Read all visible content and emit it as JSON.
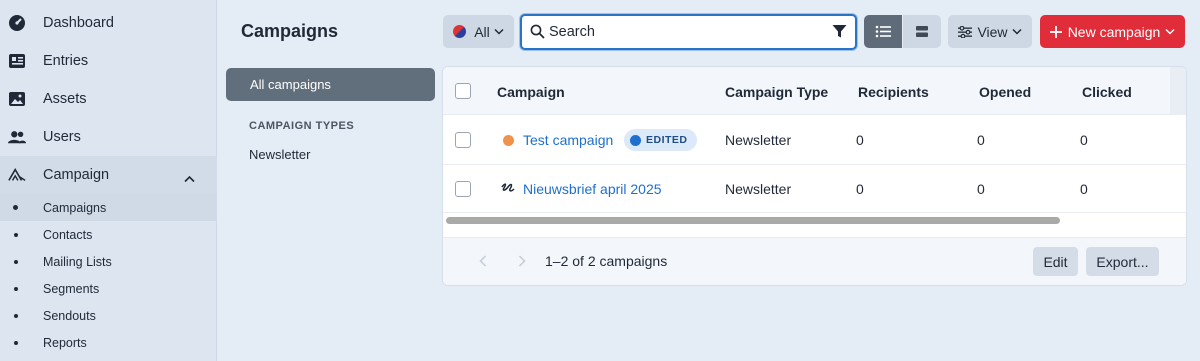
{
  "sidebar": {
    "items": [
      {
        "label": "Dashboard",
        "icon": "dashboard-icon"
      },
      {
        "label": "Entries",
        "icon": "entries-icon"
      },
      {
        "label": "Assets",
        "icon": "assets-icon"
      },
      {
        "label": "Users",
        "icon": "users-icon"
      },
      {
        "label": "Campaign",
        "icon": "campaign-icon"
      }
    ],
    "campaign_subitems": [
      {
        "label": "Campaigns",
        "selected": true
      },
      {
        "label": "Contacts"
      },
      {
        "label": "Mailing Lists"
      },
      {
        "label": "Segments"
      },
      {
        "label": "Sendouts"
      },
      {
        "label": "Reports"
      }
    ]
  },
  "page": {
    "title": "Campaigns"
  },
  "sources": {
    "all_label": "All campaigns",
    "heading": "CAMPAIGN TYPES",
    "types": [
      "Newsletter"
    ]
  },
  "toolbar": {
    "site_label": "All",
    "search_placeholder": "Search",
    "view_label": "View",
    "new_label": "New campaign"
  },
  "table": {
    "columns": [
      "Campaign",
      "Campaign Type",
      "Recipients",
      "Opened",
      "Clicked"
    ],
    "rows": [
      {
        "name": "Test campaign",
        "badge": "EDITED",
        "status": "orange-dot",
        "type": "Newsletter",
        "recipients": "0",
        "opened": "0",
        "clicked": "0"
      },
      {
        "name": "Nieuwsbrief april 2025",
        "status": "draft-icon",
        "type": "Newsletter",
        "recipients": "0",
        "opened": "0",
        "clicked": "0"
      }
    ]
  },
  "footer": {
    "page_info": "1–2 of 2 campaigns",
    "edit_label": "Edit",
    "export_label": "Export..."
  },
  "colors": {
    "accent": "#1f6fce",
    "new_button": "#e12d39",
    "selected_source": "#616e7c"
  }
}
